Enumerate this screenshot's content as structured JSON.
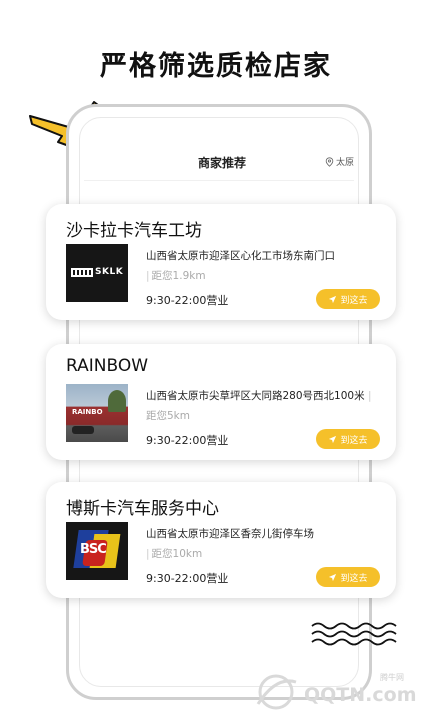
{
  "headline": "严格筛选质检店家",
  "header": {
    "title": "商家推荐",
    "location_label": "太原",
    "location_icon": "location-pin-icon"
  },
  "stores": [
    {
      "name": "沙卡拉卡汽车工坊",
      "address": "山西省太原市迎泽区心化工市场东南门口",
      "distance": "距您1.9km",
      "hours": "9:30-22:00营业",
      "logo_text": "SKLK",
      "button_label": "到这去"
    },
    {
      "name": "RAINBOW",
      "address": "山西省太原市尖草坪区大同路280号西北100米",
      "distance": "距您5km",
      "hours": "9:30-22:00营业",
      "photo_sign": "RAINBO",
      "button_label": "到这去"
    },
    {
      "name": "博斯卡汽车服务中心",
      "address": "山西省太原市迎泽区香奈儿街停车场",
      "distance": "距您10km",
      "hours": "9:30-22:00营业",
      "logo_text": "BSC",
      "button_label": "到这去"
    }
  ],
  "watermark": {
    "brand": "腾牛网",
    "domain": "QQTN.com"
  },
  "colors": {
    "accent": "#f5c02a",
    "bolt": "#f5c02a"
  }
}
